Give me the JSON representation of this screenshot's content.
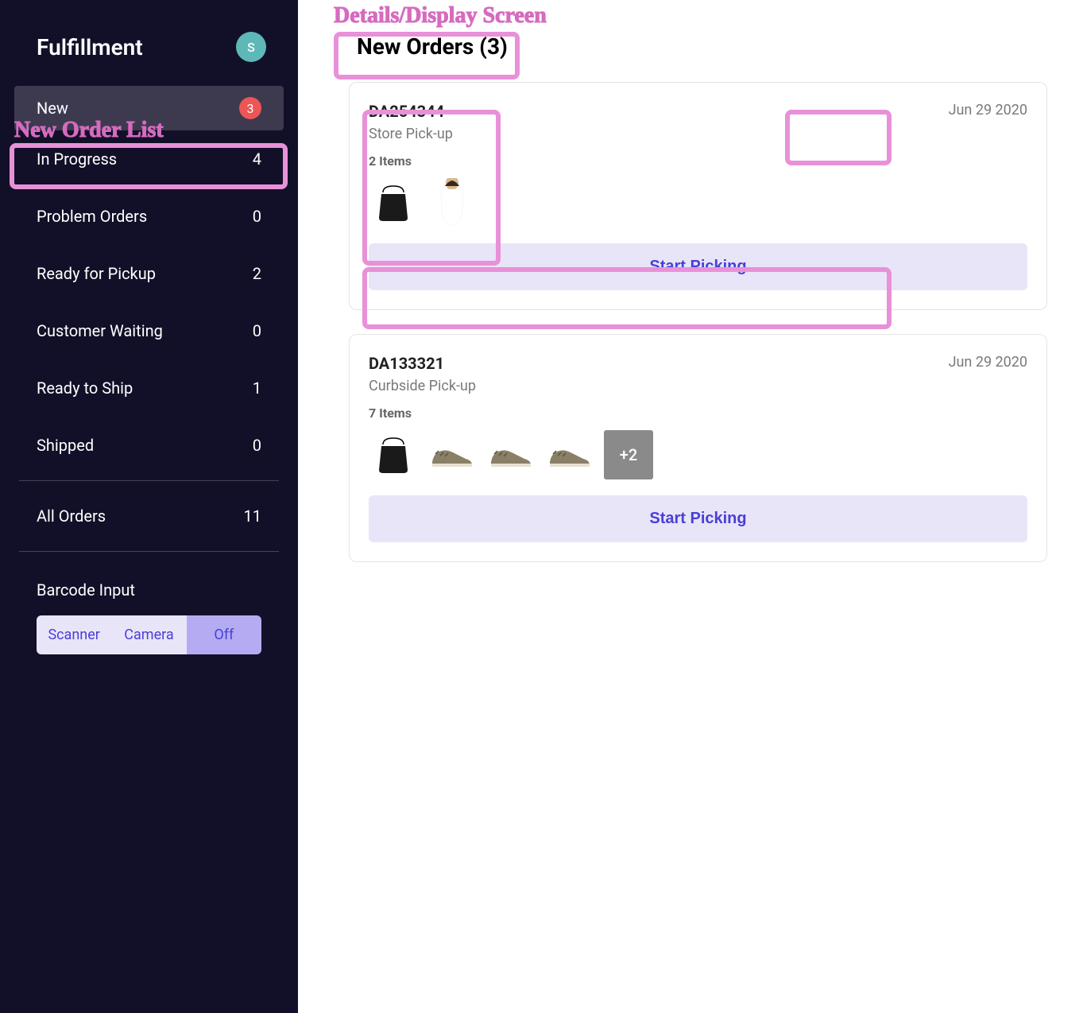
{
  "sidebar": {
    "title": "Fulfillment",
    "avatar_initial": "S",
    "nav_items": [
      {
        "label": "New",
        "count": "3",
        "active": true,
        "badge": true
      },
      {
        "label": "In Progress",
        "count": "4"
      },
      {
        "label": "Problem Orders",
        "count": "0"
      },
      {
        "label": "Ready for Pickup",
        "count": "2"
      },
      {
        "label": "Customer Waiting",
        "count": "0"
      },
      {
        "label": "Ready to Ship",
        "count": "1"
      },
      {
        "label": "Shipped",
        "count": "0"
      }
    ],
    "all_orders": {
      "label": "All Orders",
      "count": "11"
    },
    "barcode": {
      "title": "Barcode Input",
      "options": [
        "Scanner",
        "Camera",
        "Off"
      ],
      "active": "Off"
    }
  },
  "main": {
    "heading": "New Orders (3)",
    "orders": [
      {
        "id": "DA254344",
        "type": "Store Pick-up",
        "date": "Jun 29 2020",
        "items_label": "2 Items",
        "button": "Start Picking",
        "thumbs": [
          "bag",
          "dress"
        ],
        "more": null
      },
      {
        "id": "DA133321",
        "type": "Curbside Pick-up",
        "date": "Jun 29 2020",
        "items_label": "7 Items",
        "button": "Start Picking",
        "thumbs": [
          "bag",
          "shoe",
          "shoe",
          "shoe"
        ],
        "more": "+2"
      }
    ]
  },
  "annotations": {
    "sidebar_label": "New Order List",
    "main_label": "Details/Display Screen"
  }
}
